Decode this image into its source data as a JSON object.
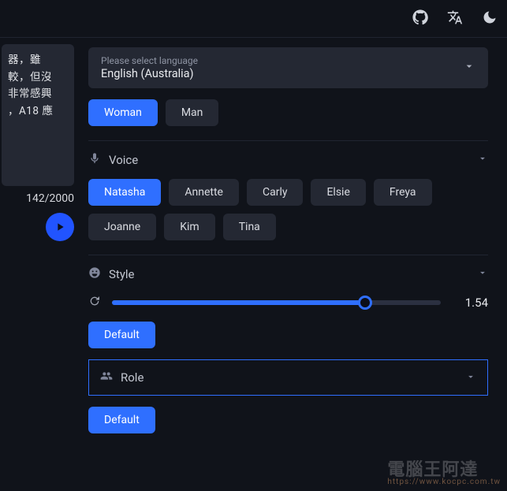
{
  "topbar": {
    "icons": [
      "github-icon",
      "translate-icon",
      "moon-icon"
    ]
  },
  "input": {
    "text_lines": [
      "器，雖",
      "較，但沒",
      "非常感興",
      "，A18 應"
    ],
    "counter": "142/2000"
  },
  "language": {
    "label": "Please select language",
    "value": "English (Australia)"
  },
  "gender": {
    "options": [
      "Woman",
      "Man"
    ],
    "selected": "Woman"
  },
  "voice": {
    "title": "Voice",
    "options": [
      "Natasha",
      "Annette",
      "Carly",
      "Elsie",
      "Freya",
      "Joanne",
      "Kim",
      "Tina"
    ],
    "selected": "Natasha"
  },
  "style": {
    "title": "Style",
    "slider_value": "1.54",
    "slider_percent": 77,
    "default_label": "Default"
  },
  "role": {
    "title": "Role",
    "default_label": "Default"
  },
  "watermark": {
    "main": "電腦王阿達",
    "sub": "https://www.kocpc.com.tw"
  }
}
